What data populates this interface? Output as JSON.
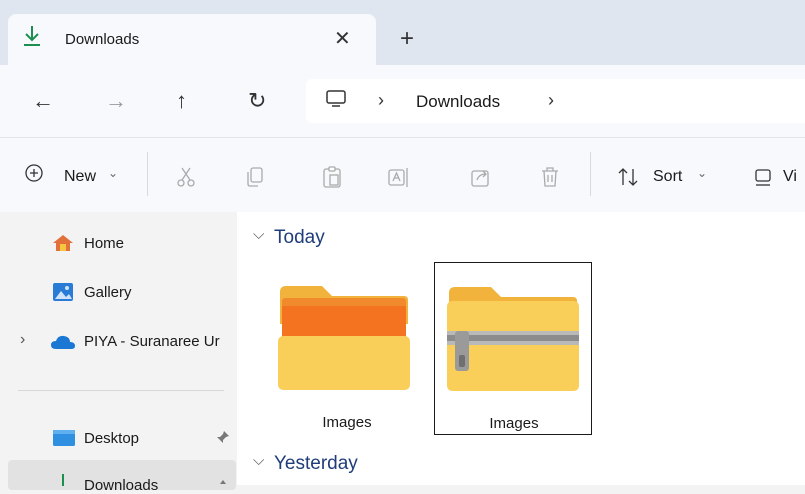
{
  "tab": {
    "title": "Downloads",
    "close": "✕",
    "new_tab": "+"
  },
  "nav": {
    "back": "←",
    "forward": "→",
    "up": "↑",
    "refresh": "↻"
  },
  "address": {
    "separator": "›",
    "crumbs": [
      "Downloads"
    ]
  },
  "commands": {
    "new_label": "New",
    "chevron": "⌄",
    "sort_label": "Sort",
    "view_label": "Vi"
  },
  "sidebar": {
    "items": [
      {
        "label": "Home",
        "icon": "home-icon"
      },
      {
        "label": "Gallery",
        "icon": "gallery-icon"
      },
      {
        "label": "PIYA - Suranaree Ur",
        "icon": "onedrive-cloud-icon",
        "expander": "›"
      },
      {
        "label": "Desktop",
        "icon": "desktop-folder-icon",
        "pin": "pin-icon"
      },
      {
        "label": "Downloads",
        "icon": "download-icon",
        "pin": "pin-icon"
      }
    ]
  },
  "groups": [
    {
      "header": "Today",
      "chevron": "⌵"
    },
    {
      "header": "Yesterday",
      "chevron": "⌵"
    }
  ],
  "files": [
    {
      "name": "Images",
      "type": "folder"
    },
    {
      "name": "Images",
      "type": "zip-folder"
    }
  ],
  "colors": {
    "accent": "#1f3d7a",
    "download_green": "#1a8f4e",
    "folder_yellow": "#f7c641"
  }
}
